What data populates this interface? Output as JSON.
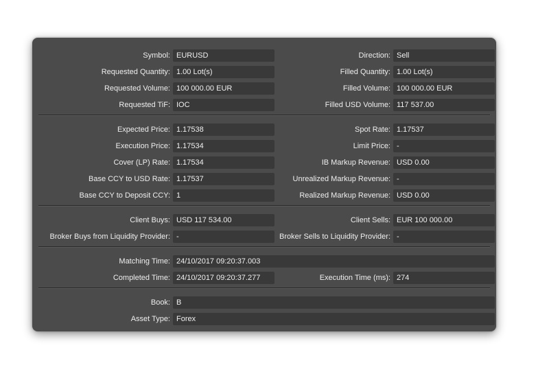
{
  "section1": {
    "symbol": {
      "label": "Symbol:",
      "value": "EURUSD"
    },
    "direction": {
      "label": "Direction:",
      "value": "Sell"
    },
    "requested_quantity": {
      "label": "Requested Quantity:",
      "value": "1.00 Lot(s)"
    },
    "filled_quantity": {
      "label": "Filled Quantity:",
      "value": "1.00 Lot(s)"
    },
    "requested_volume": {
      "label": "Requested Volume:",
      "value": "100 000.00 EUR"
    },
    "filled_volume": {
      "label": "Filled Volume:",
      "value": "100 000.00 EUR"
    },
    "requested_tif": {
      "label": "Requested TiF:",
      "value": "IOC"
    },
    "filled_usd_volume": {
      "label": "Filled USD Volume:",
      "value": "117 537.00"
    }
  },
  "section2": {
    "expected_price": {
      "label": "Expected Price:",
      "value": "1.17538"
    },
    "spot_rate": {
      "label": "Spot Rate:",
      "value": "1.17537"
    },
    "execution_price": {
      "label": "Execution Price:",
      "value": "1.17534"
    },
    "limit_price": {
      "label": "Limit Price:",
      "value": "-"
    },
    "cover_rate": {
      "label": "Cover (LP) Rate:",
      "value": "1.17534"
    },
    "ib_markup_revenue": {
      "label": "IB Markup Revenue:",
      "value": "USD 0.00"
    },
    "base_ccy_usd_rate": {
      "label": "Base CCY to USD Rate:",
      "value": "1.17537"
    },
    "unrealized_markup_revenue": {
      "label": "Unrealized Markup Revenue:",
      "value": "-"
    },
    "base_ccy_deposit_ccy": {
      "label": "Base CCY to Deposit CCY:",
      "value": "1"
    },
    "realized_markup_revenue": {
      "label": "Realized Markup Revenue:",
      "value": "USD 0.00"
    }
  },
  "section3": {
    "client_buys": {
      "label": "Client Buys:",
      "value": "USD 117 534.00"
    },
    "client_sells": {
      "label": "Client Sells:",
      "value": "EUR 100 000.00"
    },
    "broker_buys_lp": {
      "label": "Broker Buys from Liquidity Provider:",
      "value": "-"
    },
    "broker_sells_lp": {
      "label": "Broker Sells to Liquidity Provider:",
      "value": "-"
    }
  },
  "section4": {
    "matching_time": {
      "label": "Matching Time:",
      "value": "24/10/2017 09:20:37.003"
    },
    "completed_time": {
      "label": "Completed Time:",
      "value": "24/10/2017 09:20:37.277"
    },
    "execution_time_ms": {
      "label": "Execution Time (ms):",
      "value": "274"
    }
  },
  "section5": {
    "book": {
      "label": "Book:",
      "value": "B"
    },
    "asset_type": {
      "label": "Asset Type:",
      "value": "Forex"
    }
  }
}
